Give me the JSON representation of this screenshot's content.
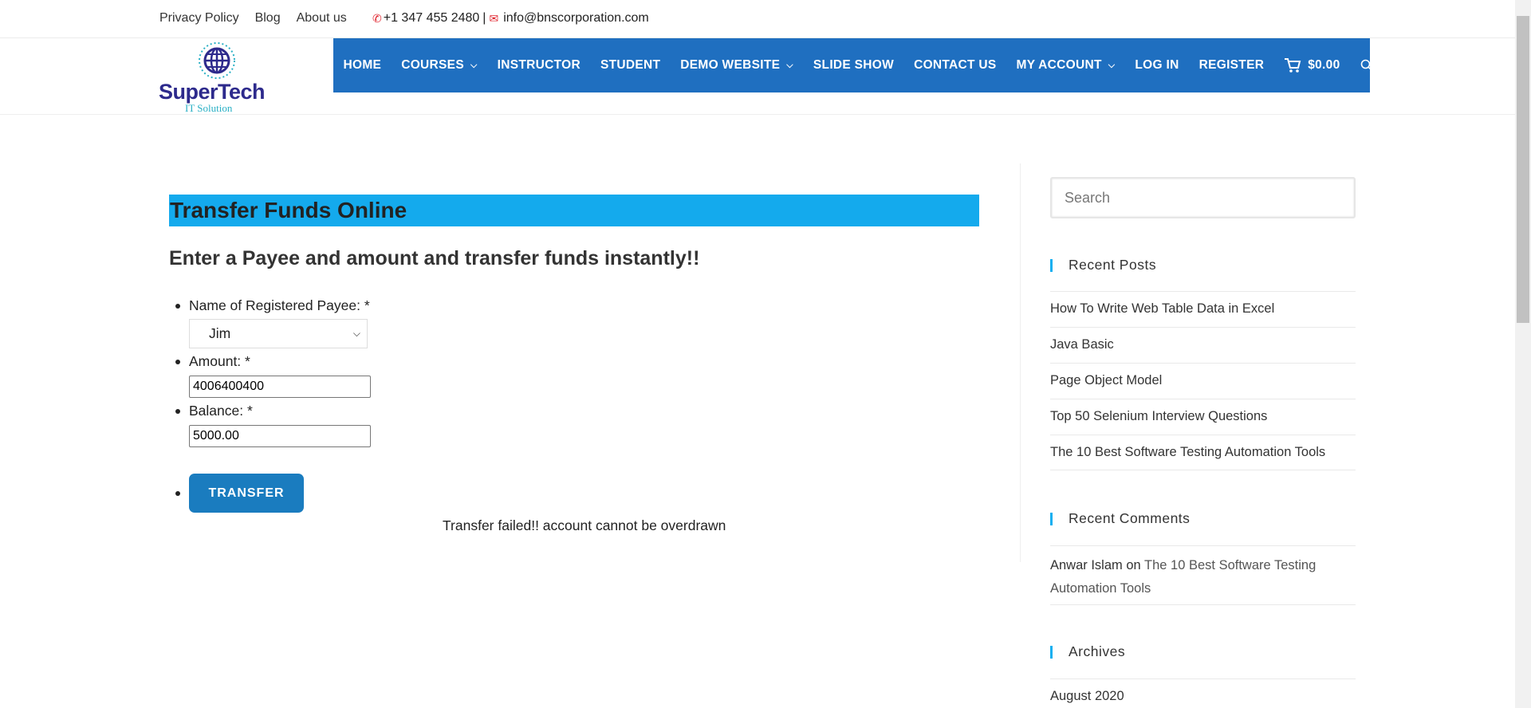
{
  "topbar": {
    "links": [
      "Privacy Policy",
      "Blog",
      "About us"
    ],
    "phone": "+1 347 455 2480",
    "separator": "|",
    "email": "info@bnscorporation.com"
  },
  "logo": {
    "title": "SuperTech",
    "subtitle": "IT Solution"
  },
  "nav": {
    "items": [
      "HOME",
      "COURSES",
      "INSTRUCTOR",
      "STUDENT",
      "DEMO WEBSITE",
      "SLIDE SHOW",
      "CONTACT US",
      "MY ACCOUNT",
      "LOG IN",
      "REGISTER"
    ],
    "cart_total": "$0.00"
  },
  "main": {
    "title": "Transfer Funds Online",
    "subtitle": "Enter a Payee and amount and transfer funds instantly!!",
    "payee_label": "Name of Registered Payee: *",
    "payee_value": "Jim",
    "amount_label": "Amount: *",
    "amount_value": "4006400400",
    "balance_label": "Balance: *",
    "balance_value": "5000.00",
    "button": "TRANSFER",
    "message": "Transfer failed!! account cannot be overdrawn"
  },
  "sidebar": {
    "search_placeholder": "Search",
    "recent_posts_title": "Recent Posts",
    "recent_posts": [
      "How To Write Web Table Data in Excel",
      "Java Basic",
      "Page Object Model",
      "Top 50 Selenium Interview Questions",
      "The 10 Best Software Testing Automation Tools"
    ],
    "recent_comments_title": "Recent Comments",
    "comment_author": "Anwar Islam",
    "comment_on": "on",
    "comment_post": "The 10 Best Software Testing Automation Tools",
    "archives_title": "Archives",
    "archives": [
      "August 2020"
    ]
  },
  "colors": {
    "nav_bg": "#1f6fc0",
    "banner_bg": "#14aaed",
    "button_bg": "#1a7cbf",
    "accent": "#13aff0"
  }
}
